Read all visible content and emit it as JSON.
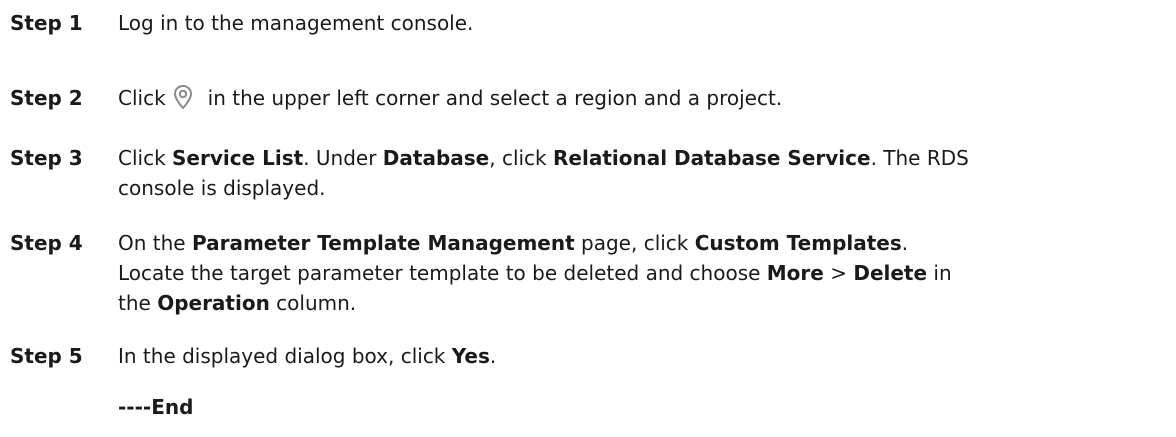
{
  "steps": [
    {
      "label": "Step 1",
      "segments": [
        {
          "text": "Log in to the management console.",
          "bold": false
        }
      ]
    },
    {
      "label": "Step 2",
      "before_icon": "Click",
      "icon": "location-pin-icon",
      "after_icon": "in the upper left corner and select a region and a project."
    },
    {
      "label": "Step 3",
      "segments": [
        {
          "text": "Click ",
          "bold": false
        },
        {
          "text": "Service List",
          "bold": true
        },
        {
          "text": ". Under ",
          "bold": false
        },
        {
          "text": "Database",
          "bold": true
        },
        {
          "text": ", click ",
          "bold": false
        },
        {
          "text": "Relational Database Service",
          "bold": true
        },
        {
          "text": ". The RDS",
          "bold": false
        },
        {
          "text": "\n",
          "bold": false
        },
        {
          "text": "console is displayed.",
          "bold": false
        }
      ]
    },
    {
      "label": "Step 4",
      "segments": [
        {
          "text": "On the ",
          "bold": false
        },
        {
          "text": "Parameter Template Management",
          "bold": true
        },
        {
          "text": " page, click ",
          "bold": false
        },
        {
          "text": "Custom Templates",
          "bold": true
        },
        {
          "text": ".",
          "bold": false
        },
        {
          "text": "\n",
          "bold": false
        },
        {
          "text": "Locate the target parameter template to be deleted and choose ",
          "bold": false
        },
        {
          "text": "More",
          "bold": true
        },
        {
          "text": " > ",
          "bold": false
        },
        {
          "text": "Delete",
          "bold": true
        },
        {
          "text": " in",
          "bold": false
        },
        {
          "text": "\n",
          "bold": false
        },
        {
          "text": "the ",
          "bold": false
        },
        {
          "text": "Operation",
          "bold": true
        },
        {
          "text": " column.",
          "bold": false
        }
      ]
    },
    {
      "label": "Step 5",
      "segments": [
        {
          "text": "In the displayed dialog box, click ",
          "bold": false
        },
        {
          "text": "Yes",
          "bold": true
        },
        {
          "text": ".",
          "bold": false
        }
      ]
    }
  ],
  "end_marker": "----End",
  "icon_color": "#8a8a8a"
}
